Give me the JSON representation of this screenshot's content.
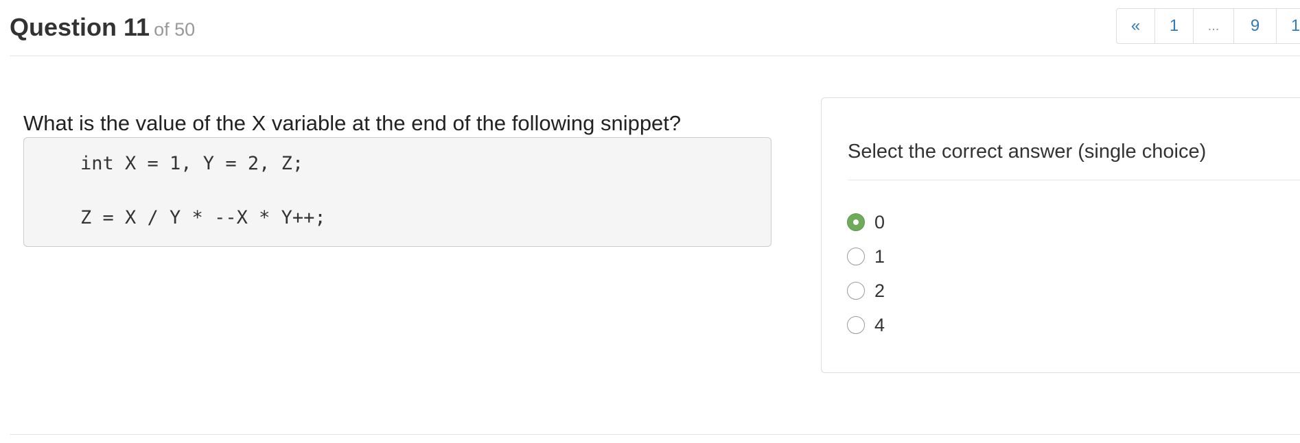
{
  "header": {
    "question_label": "Question 11",
    "of_label": "of 50"
  },
  "pagination": {
    "prev_label": "«",
    "pages": [
      "1",
      "...",
      "9",
      "1"
    ]
  },
  "question": {
    "text": "What is the value of the X variable at the end of the following snippet?",
    "code_lines": [
      "int X = 1, Y = 2, Z;",
      "Z = X / Y * --X * Y++;"
    ]
  },
  "answer_panel": {
    "heading": "Select the correct answer (single choice)",
    "options": [
      {
        "label": "0",
        "selected": true
      },
      {
        "label": "1",
        "selected": false
      },
      {
        "label": "2",
        "selected": false
      },
      {
        "label": "4",
        "selected": false
      }
    ]
  },
  "colors": {
    "link": "#337ab7",
    "selected_radio": "#6eac5c",
    "code_background": "#f5f5f5"
  }
}
